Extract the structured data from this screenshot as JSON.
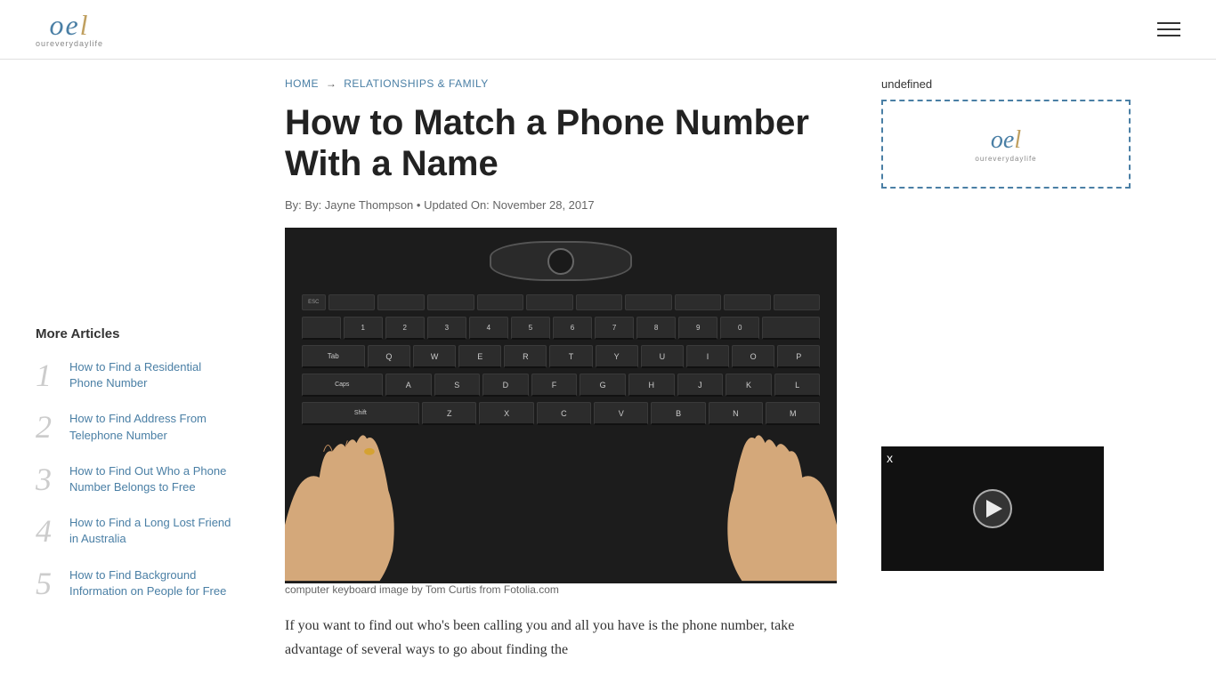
{
  "header": {
    "logo_main": "oel",
    "logo_sub": "oureverydaylife"
  },
  "breadcrumb": {
    "home": "HOME",
    "arrow": "→",
    "category": "RELATIONSHIPS & FAMILY"
  },
  "article": {
    "title": "How to Match a Phone Number With a Name",
    "byline": "By: Jayne Thompson",
    "updated_label": "Updated On:",
    "date": "November 28, 2017",
    "image_caption": "computer keyboard image by Tom Curtis from Fotolia.com",
    "body_text": "If you want to find out who's been calling you and all you have is the phone number, take advantage of several ways to go about finding the"
  },
  "more_articles": {
    "title": "More Articles",
    "items": [
      {
        "number": "1",
        "text": "How to Find a Residential Phone Number",
        "href": "#"
      },
      {
        "number": "2",
        "text": "How to Find Address From Telephone Number",
        "href": "#"
      },
      {
        "number": "3",
        "text": "How to Find Out Who a Phone Number Belongs to Free",
        "href": "#"
      },
      {
        "number": "4",
        "text": "How to Find a Long Lost Friend in Australia",
        "href": "#"
      },
      {
        "number": "5",
        "text": "How to Find Background Information on People for Free",
        "href": "#"
      }
    ]
  },
  "right_sidebar": {
    "undefined_label": "undefined",
    "ad_logo": "oel",
    "ad_logo_sub": "oureverydaylife",
    "video_close": "x"
  },
  "keyboard_rows": [
    [
      "Q",
      "W",
      "E",
      "R",
      "T",
      "Y",
      "U",
      "I",
      "O",
      "P"
    ],
    [
      "A",
      "S",
      "D",
      "F",
      "G",
      "H",
      "J",
      "K",
      "L"
    ],
    [
      "Z",
      "X",
      "C",
      "V",
      "B",
      "N",
      "M"
    ]
  ]
}
